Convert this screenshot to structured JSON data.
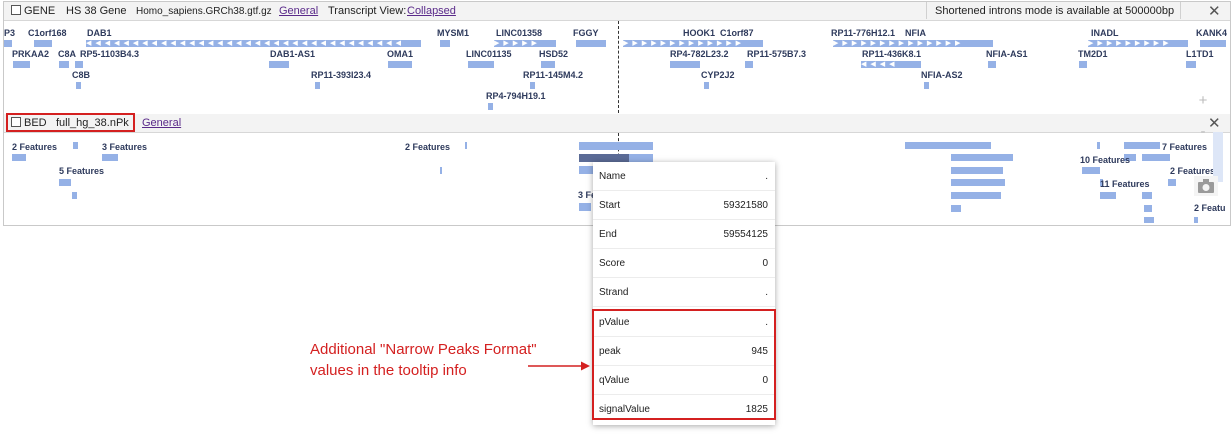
{
  "gene_track": {
    "type_label": "GENE",
    "name": "HS 38 Gene",
    "file": "Homo_sapiens.GRCh38.gtf.gz",
    "general_link": "General",
    "transcript_view_label": "Transcript View:",
    "transcript_view_value": "Collapsed",
    "notice": "Shortened introns mode is available at 500000bp",
    "close_glyph": "✕",
    "genes": [
      "P3",
      "C1orf168",
      "DAB1",
      "PRKAA2",
      "C8A",
      "RP5-1103B4.3",
      "C8B",
      "DAB1-AS1",
      "RP11-393I23.4",
      "OMA1",
      "MYSM1",
      "LINC01358",
      "LINC01135",
      "HSD52",
      "RP11-145M4.2",
      "RP4-794H19.1",
      "FGGY",
      "HOOK1",
      "C1orf87",
      "RP4-782L23.2",
      "RP11-575B7.3",
      "CYP2J2",
      "RP11-776H12.1",
      "NFIA",
      "RP11-436K8.1",
      "NFIA-AS1",
      "NFIA-AS2",
      "INADL",
      "TM2D1",
      "KANK4",
      "L1TD1"
    ]
  },
  "bed_track": {
    "type_label": "BED",
    "name": "full_hg_38.nPk",
    "general_link": "General",
    "close_glyph": "✕",
    "feature_labels": [
      "2 Features",
      "3 Features",
      "5 Features",
      "2 Features",
      "3 Fe",
      "10 Features",
      "7 Features",
      "2 Features",
      "11 Features",
      "2 Featu"
    ]
  },
  "tooltip": {
    "rows": [
      {
        "key": "Name",
        "value": "."
      },
      {
        "key": "Start",
        "value": "59321580"
      },
      {
        "key": "End",
        "value": "59554125"
      },
      {
        "key": "Score",
        "value": "0"
      },
      {
        "key": "Strand",
        "value": "."
      },
      {
        "key": "pValue",
        "value": "."
      },
      {
        "key": "peak",
        "value": "945"
      },
      {
        "key": "qValue",
        "value": "0"
      },
      {
        "key": "signalValue",
        "value": "1825"
      }
    ]
  },
  "side_controls": {
    "zoom_in": "+",
    "zoom_out": "-",
    "camera": "camera-icon"
  },
  "annotation": {
    "line1": "Additional \"Narrow Peaks Format\"",
    "line2": "values in the tooltip info"
  },
  "colors": {
    "feature": "#95b1e6",
    "highlight": "#d42020",
    "selected_feature": "#5b6b96"
  }
}
